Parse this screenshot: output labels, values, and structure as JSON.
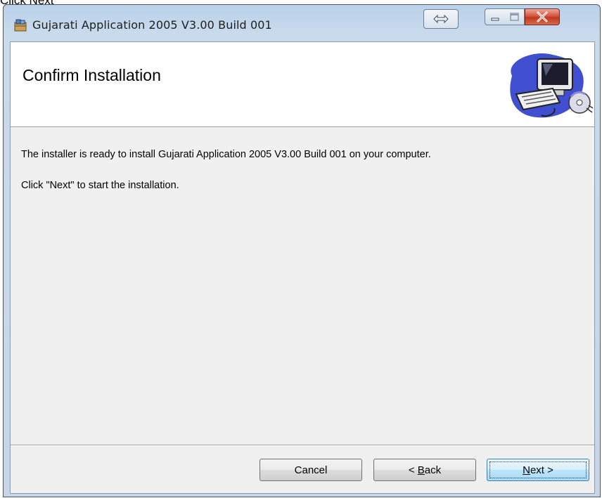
{
  "caption": "Click Next",
  "window": {
    "title": "Gujarati Application 2005 V3.00 Build 001",
    "controls": {
      "resize_glyph": "⇔",
      "close_glyph": "X"
    }
  },
  "banner": {
    "title": "Confirm Installation",
    "art_icon": "computer-with-cd-icon"
  },
  "body": {
    "message_1": "The installer is ready to install Gujarati Application 2005 V3.00 Build 001 on your computer.",
    "message_2": "Click \"Next\" to start the installation."
  },
  "buttons": {
    "cancel": "Cancel",
    "back_prefix": "< ",
    "back_mnemonic": "B",
    "back_rest": "ack",
    "next_mnemonic": "N",
    "next_rest": "ext >"
  },
  "colors": {
    "titlebar": "#c9daec",
    "client": "#f0f0f0",
    "close": "#c0381f",
    "default_button_border": "#3c7fb1"
  }
}
